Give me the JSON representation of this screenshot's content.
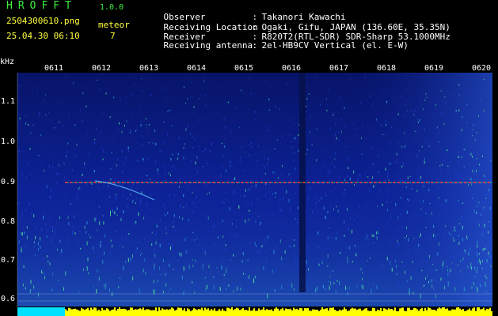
{
  "header": {
    "app_title": "HROFFT",
    "app_version": "1.0.0",
    "filename": "2504300610.png",
    "datetime": "25.04.30 06:10",
    "meteor_label": "meteor",
    "meteor_count": "7"
  },
  "info": [
    {
      "label": "Observer",
      "value": "Takanori Kawachi"
    },
    {
      "label": "Receiving Location",
      "value": "Ogaki, Gifu, JAPAN (136.60E, 35.35N)"
    },
    {
      "label": "Receiver",
      "value": "R820T2(RTL-SDR) SDR-Sharp 53.1000MHz"
    },
    {
      "label": "Receiving antenna",
      "value": "2el-HB9CV Vertical (el. E-W)"
    }
  ],
  "spectrogram": {
    "y_unit": "kHz",
    "y_ticks": [
      "1.1",
      "1.0",
      "0.9",
      "0.8",
      "0.7",
      "0.6"
    ],
    "time_labels": [
      "0611",
      "0612",
      "0613",
      "0614",
      "0615",
      "0616",
      "0617",
      "0618",
      "0619",
      "0620"
    ],
    "colors": {
      "background": "#0a1a8c",
      "noise_low": "#1e3cc8",
      "noise_mid": "#2ea0d8",
      "noise_high": "#50e0a0",
      "carrier": "#ff4040",
      "baseline_bar": "#ffff00",
      "cyan_block": "#00e0ff"
    }
  }
}
